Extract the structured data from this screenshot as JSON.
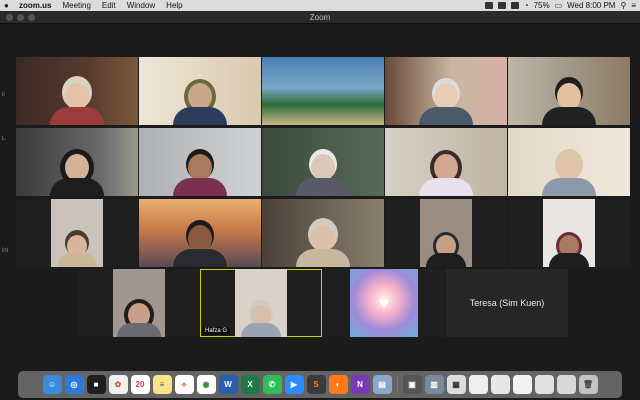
{
  "menubar": {
    "app": "zoom.us",
    "menus": [
      "Meeting",
      "Edit",
      "Window",
      "Help"
    ],
    "battery": "75%",
    "clock": "Wed 8:00 PM"
  },
  "window": {
    "title": "Zoom"
  },
  "edge_labels": [
    "ii",
    "L",
    "int"
  ],
  "participants": {
    "hafza": "Hafza G",
    "teresa": "Teresa (Sim Kuen)"
  },
  "dock": {
    "calendar_day": "20",
    "items": [
      "finder-icon",
      "safari-icon",
      "jetbrains-icon",
      "photos-icon",
      "calendar-icon",
      "notes-icon",
      "acrobat-icon",
      "chrome-icon",
      "word-icon",
      "excel-icon",
      "whatsapp-icon",
      "zoom-icon",
      "sublime-icon",
      "firefox-icon",
      "onenote-icon",
      "preview-icon",
      "screenshot-icon",
      "mission-control-icon",
      "documents-icon",
      "window-1",
      "window-2",
      "window-3",
      "window-4",
      "window-5",
      "trash-icon"
    ]
  },
  "colors": {
    "active_speaker": "#c8d400",
    "tile_bg": "#2b2b2b"
  }
}
